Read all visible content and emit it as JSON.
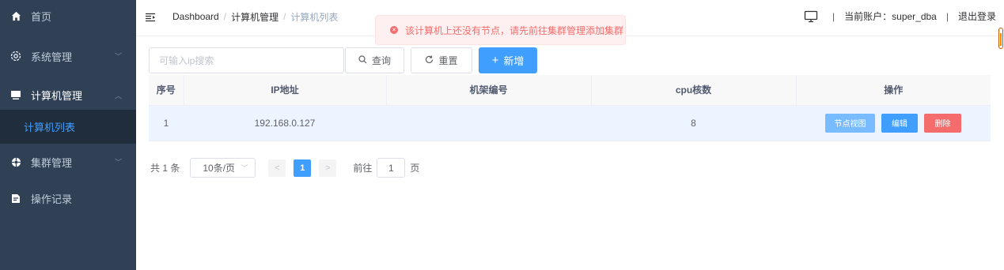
{
  "sidebar": {
    "items": [
      {
        "label": "首页",
        "icon": "home-icon"
      },
      {
        "label": "系统管理",
        "icon": "settings-icon",
        "arrow": "﹀"
      },
      {
        "label": "计算机管理",
        "icon": "monitor-icon",
        "arrow": "︿"
      },
      {
        "label": "集群管理",
        "icon": "cluster-icon",
        "arrow": "﹀"
      },
      {
        "label": "操作记录",
        "icon": "log-icon"
      }
    ],
    "subitem": "计算机列表"
  },
  "breadcrumb": {
    "home": "Dashboard",
    "separator": "/",
    "parent": "计算机管理",
    "current": "计算机列表"
  },
  "navbar": {
    "account_label": "当前账户：super_dba",
    "separator": "|",
    "logout": "退出登录"
  },
  "toast": {
    "message": "该计算机上还没有节点，请先前往集群管理添加集群",
    "color": "#f56c6c"
  },
  "toolbar": {
    "search_placeholder": "可输入ip搜索",
    "query_label": "查询",
    "reset_label": "重置",
    "add_label": "新增"
  },
  "table": {
    "headers": [
      "序号",
      "IP地址",
      "机架编号",
      "cpu核数",
      "操作"
    ],
    "rows": [
      {
        "index": "1",
        "ip": "192.168.0.127",
        "rack": "",
        "cpu": "8"
      }
    ],
    "actions": {
      "view": "节点视图",
      "edit": "编辑",
      "delete": "删除"
    }
  },
  "pagination": {
    "total": "共 1 条",
    "page_size": "10条/页",
    "prev": "<",
    "current_page": "1",
    "next": ">",
    "goto_label": "前往",
    "goto_value": "1",
    "page_suffix": "页"
  },
  "colors": {
    "sidebar_bg": "#304156",
    "active_submenu": "#409eff",
    "primary": "#409eff",
    "danger": "#f56c6c"
  }
}
